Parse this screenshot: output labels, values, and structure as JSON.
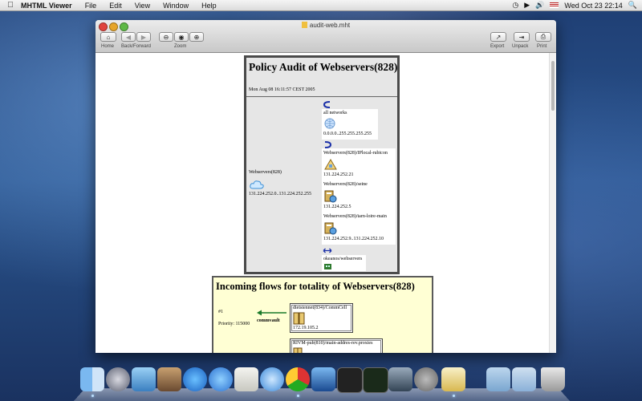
{
  "menubar": {
    "app_name": "MHTML Viewer",
    "items": [
      "File",
      "Edit",
      "View",
      "Window",
      "Help"
    ],
    "clock": "Wed Oct 23  22:14"
  },
  "window": {
    "title": "audit-web.mht",
    "toolbar": {
      "home_label": "Home",
      "back_forward_label": "Back/Forward",
      "zoom_label": "Zoom",
      "export_label": "Export",
      "unpack_label": "Unpack",
      "print_label": "Print"
    }
  },
  "audit": {
    "title": "Policy Audit of Webservers(828)",
    "date": "Mon Aug 08 16:11:57 CEST 2005",
    "source_name": "Webservers(828)",
    "source_range": "131.224.252.0..131.224.252.255",
    "entries": [
      {
        "name": "all networks",
        "value": "0.0.0.0..255.255.255.255"
      },
      {
        "name": "Webservers(828)/IPlocal-rubicon",
        "value": "131.224.252.21"
      },
      {
        "name": "Webservers(828)/seine",
        "value": "131.224.252.5"
      },
      {
        "name": "Webservers(828)/tarn-loire-main",
        "value": "131.224.252.9..131.224.252.10"
      },
      {
        "name": "okeanos/webservers",
        "value": ""
      }
    ]
  },
  "flows": {
    "title": "Incoming flows for totality of Webservers(828)",
    "rule_number": "#1",
    "priority": "Priority: 115000",
    "service": "commvault",
    "node1_name": "dietstennet(834)/CommCell",
    "node1_value": "172.19.105.2",
    "node2_name": "RIVM-pub(810)/main-addres-rev.proxies"
  },
  "colors": {
    "arrow": "#1a7a2a",
    "audit_bg": "#e6e6e6",
    "flows_bg": "#ffffd4"
  }
}
